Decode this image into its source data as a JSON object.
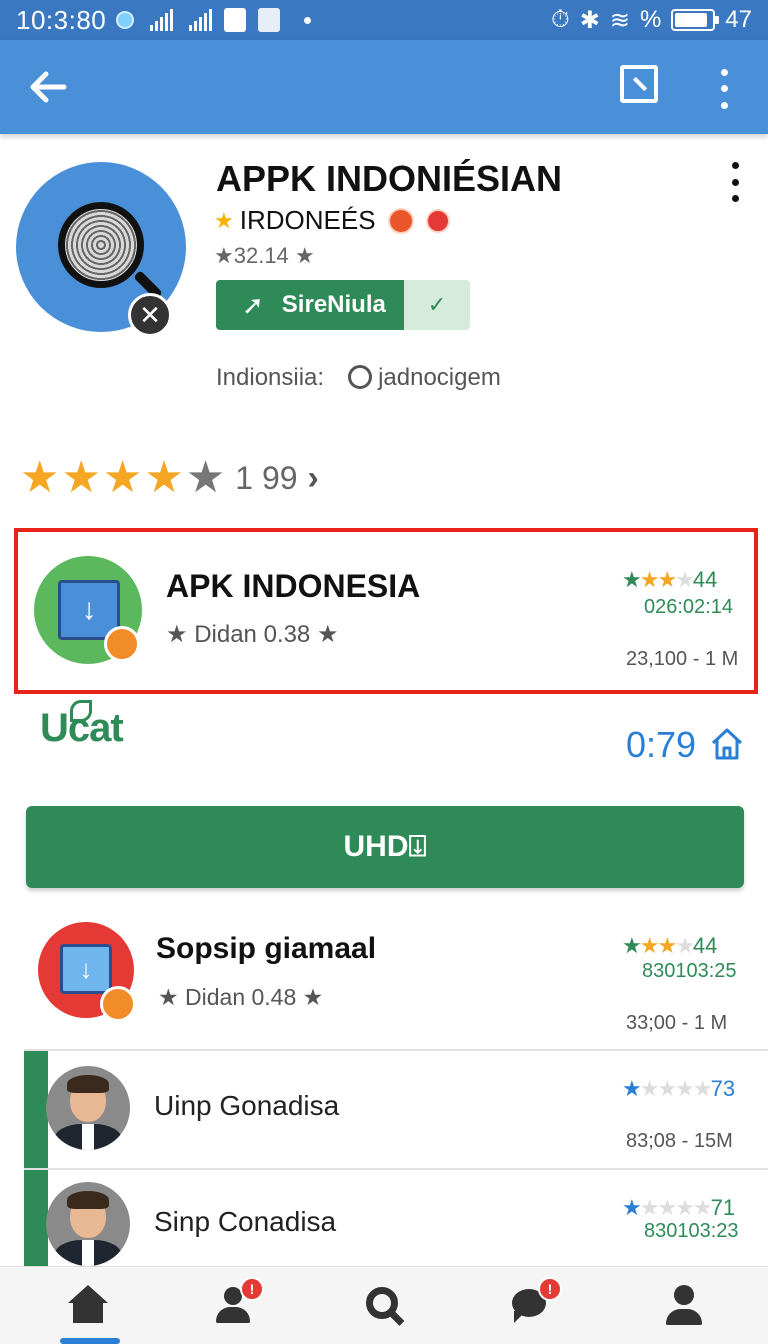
{
  "status_bar": {
    "time": "10:3:80",
    "percent_text": "%",
    "battery": "47"
  },
  "app_header": {
    "title": "APPK INDONIÉSIAN",
    "developer": "IRDONEÉS",
    "rating": "32.14",
    "action_button": "SireNiula",
    "meta_label": "Indionsiia:",
    "meta_value": "jadnocigem"
  },
  "overall_rating": {
    "stars_filled": 4,
    "stars_total": 5,
    "count": "1 99"
  },
  "highlighted_item": {
    "title": "APK INDONESIA",
    "subtitle": "Didan 0.38",
    "rating_count": "44",
    "date": "026:02:14",
    "size": "23,100 - 1 M"
  },
  "promo": {
    "logo_text": "Ucat",
    "price": "0:79",
    "button_label": "UHD"
  },
  "list_items": [
    {
      "title": "Sopsip giamaal",
      "subtitle": "Didan 0.48",
      "rating_count": "44",
      "date": "830103:25",
      "size": "33;00 - 1 M"
    }
  ],
  "people": [
    {
      "name": "Uinp Gonadisa",
      "rating_count": "73",
      "size": "83;08 - 15M"
    },
    {
      "name": "Sinp Conadisa",
      "rating_count": "71",
      "date": "830103:23"
    }
  ],
  "colors": {
    "accent_blue": "#4a90d9",
    "primary_green": "#2e8b57",
    "highlight_red": "#e8231a",
    "star_orange": "#f5a623"
  },
  "bottom_nav": {
    "items": [
      "home-icon",
      "user-icon",
      "search-icon",
      "chat-icon",
      "profile-icon"
    ],
    "badges": [
      "!",
      "!"
    ]
  }
}
